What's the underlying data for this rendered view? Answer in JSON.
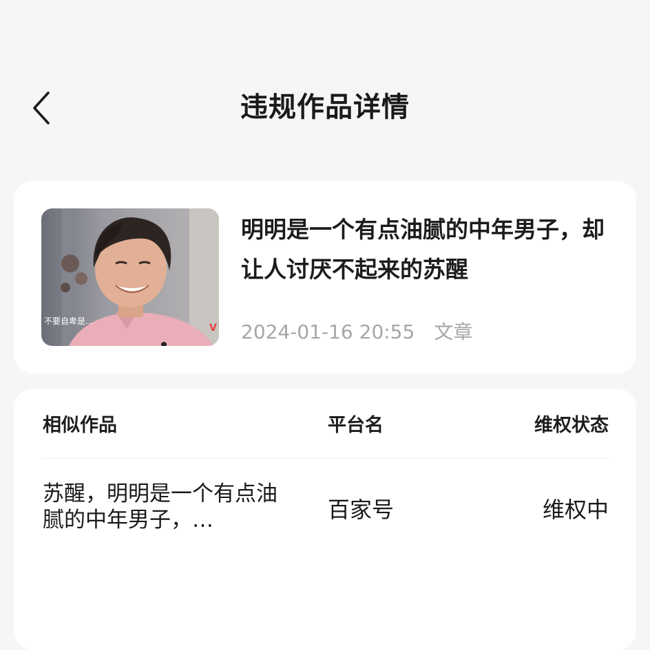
{
  "header": {
    "title": "违规作品详情",
    "back_icon": "chevron-left-icon"
  },
  "work": {
    "title": "明明是一个有点油腻的中年男子，却让人讨厌不起来的苏醒",
    "datetime": "2024-01-16 20:55",
    "type": "文章",
    "thumbnail_caption": "不要自卑是…"
  },
  "similar_table": {
    "columns": {
      "similar": "相似作品",
      "platform": "平台名",
      "status": "维权状态"
    },
    "rows": [
      {
        "similar": "苏醒，明明是一个有点油腻的中年男子，…",
        "platform": "百家号",
        "status": "维权中"
      }
    ]
  },
  "colors": {
    "background": "#f5f6f8",
    "card": "#ffffff",
    "meta_text": "#a6a6a6"
  }
}
